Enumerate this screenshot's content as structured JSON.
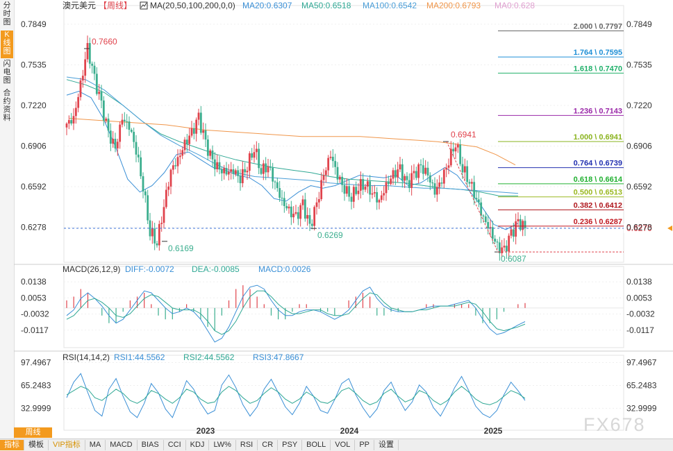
{
  "sidebar": {
    "items": [
      {
        "label": "分时图",
        "active": false
      },
      {
        "label": "K线图",
        "active": true
      },
      {
        "label": "闪电图",
        "active": false
      },
      {
        "label": "合约资料",
        "active": false
      }
    ]
  },
  "header": {
    "symbol": "澳元美元",
    "period_tag": "【周线】",
    "ma_label": "MA(20,50,100,200,0,0)",
    "ma_values": [
      {
        "label": "MA20:0.6307",
        "color": "#3a8fd6"
      },
      {
        "label": "MA50:0.6518",
        "color": "#2fa894"
      },
      {
        "label": "MA100:0.6542",
        "color": "#4a9ed8"
      },
      {
        "label": "MA200:0.6793",
        "color": "#f0964a"
      },
      {
        "label": "MA0:0.628",
        "color": "#e0a0d0"
      }
    ]
  },
  "macd_header": {
    "label": "MACD(26,12,9)",
    "values": [
      {
        "label": "DIFF:-0.0072",
        "color": "#3a8fd6"
      },
      {
        "label": "DEA:-0.0085",
        "color": "#2fa894"
      },
      {
        "label": "MACD:0.0026",
        "color": "#3a8fd6"
      }
    ]
  },
  "rsi_header": {
    "label": "RSI(14,14,2)",
    "values": [
      {
        "label": "RSI1:44.5562",
        "color": "#3a8fd6"
      },
      {
        "label": "RSI2:44.5562",
        "color": "#2fa894"
      },
      {
        "label": "RSI3:47.8667",
        "color": "#3a8fd6"
      }
    ]
  },
  "x_axis": {
    "labels": [
      "2023",
      "2024",
      "2025"
    ]
  },
  "period_button": "周线",
  "watermark": "FX678",
  "toolbar": {
    "items": [
      "指标",
      "模板",
      "VIP指标",
      "MA",
      "MACD",
      "BIAS",
      "CCI",
      "KDJ",
      "LW%",
      "RSI",
      "CR",
      "PSY",
      "BOLL",
      "VOL",
      "PP",
      "设置"
    ]
  },
  "colors": {
    "up": "#e0434c",
    "down": "#3bae8e",
    "current_price": "#e0434c"
  },
  "chart_data": {
    "type": "candlestick",
    "price_axis": {
      "ticks": [
        "0.7849",
        "0.7535",
        "0.7220",
        "0.6906",
        "0.6592",
        "0.6278"
      ],
      "ylim": [
        0.605,
        0.795
      ]
    },
    "current_price": "0.6270",
    "fib_levels": [
      {
        "label": "2.000 \\ 0.7797",
        "value": 0.7797,
        "color": "#666666"
      },
      {
        "label": "1.764 \\ 0.7595",
        "value": 0.7595,
        "color": "#1e8fd6"
      },
      {
        "label": "1.618 \\ 0.7470",
        "value": 0.747,
        "color": "#20b06a"
      },
      {
        "label": "1.236 \\ 0.7143",
        "value": 0.7143,
        "color": "#9a28a8"
      },
      {
        "label": "1.000 \\ 0.6941",
        "value": 0.6941,
        "color": "#8ab31e"
      },
      {
        "label": "0.764 \\ 0.6739",
        "value": 0.6739,
        "color": "#2230b0"
      },
      {
        "label": "0.618 \\ 0.6614",
        "value": 0.6614,
        "color": "#20b030"
      },
      {
        "label": "0.500 \\ 0.6513",
        "value": 0.6513,
        "color": "#9ab820"
      },
      {
        "label": "0.382 \\ 0.6412",
        "value": 0.6412,
        "color": "#b0181e"
      },
      {
        "label": "0.236 \\ 0.6287",
        "value": 0.6287,
        "color": "#c01820"
      }
    ],
    "price_annotations": [
      {
        "label": "0.7660",
        "value": 0.766,
        "color": "#e0434c"
      },
      {
        "label": "0.6169",
        "value": 0.6169,
        "color": "#3bae8e"
      },
      {
        "label": "0.6269",
        "value": 0.6269,
        "color": "#3bae8e"
      },
      {
        "label": "0.6941",
        "value": 0.6941,
        "color": "#e0434c"
      },
      {
        "label": "0.6087",
        "value": 0.6087,
        "color": "#3bae8e"
      }
    ],
    "trend_line": {
      "from": 0.6941,
      "to": 0.6087
    },
    "anchors": [
      0.708,
      0.712,
      0.738,
      0.766,
      0.742,
      0.722,
      0.7,
      0.688,
      0.712,
      0.706,
      0.688,
      0.66,
      0.625,
      0.617,
      0.645,
      0.672,
      0.68,
      0.692,
      0.7,
      0.712,
      0.692,
      0.678,
      0.672,
      0.67,
      0.672,
      0.666,
      0.676,
      0.69,
      0.672,
      0.676,
      0.662,
      0.648,
      0.64,
      0.635,
      0.645,
      0.627,
      0.645,
      0.668,
      0.684,
      0.668,
      0.658,
      0.652,
      0.66,
      0.662,
      0.655,
      0.648,
      0.66,
      0.668,
      0.672,
      0.66,
      0.668,
      0.674,
      0.668,
      0.655,
      0.665,
      0.68,
      0.694,
      0.674,
      0.664,
      0.65,
      0.635,
      0.625,
      0.612,
      0.609,
      0.622,
      0.631,
      0.627
    ],
    "ma_lines": [
      {
        "name": "MA20",
        "color": "#3a8fd6",
        "points": [
          0.73,
          0.733,
          0.728,
          0.712,
          0.69,
          0.665,
          0.655,
          0.66,
          0.67,
          0.684,
          0.686,
          0.68,
          0.674,
          0.672,
          0.668,
          0.666,
          0.66,
          0.65,
          0.648,
          0.655,
          0.66,
          0.658,
          0.66,
          0.664,
          0.668,
          0.667,
          0.666,
          0.668,
          0.66,
          0.662,
          0.668,
          0.674,
          0.668,
          0.656,
          0.644,
          0.63,
          0.626,
          0.631
        ]
      },
      {
        "name": "MA50",
        "color": "#2fa894",
        "points": [
          0.742,
          0.738,
          0.732,
          0.722,
          0.71,
          0.7,
          0.694,
          0.689,
          0.684,
          0.68,
          0.677,
          0.674,
          0.672,
          0.67,
          0.667,
          0.665,
          0.664,
          0.663,
          0.662,
          0.66,
          0.658,
          0.657,
          0.655,
          0.652,
          0.652
        ]
      },
      {
        "name": "MA100",
        "color": "#4a9ed8",
        "points": [
          0.744,
          0.742,
          0.734,
          0.722,
          0.71,
          0.699,
          0.691,
          0.684,
          0.676,
          0.67,
          0.667,
          0.666,
          0.665,
          0.664,
          0.662,
          0.661,
          0.66,
          0.66,
          0.659,
          0.658,
          0.658,
          0.657,
          0.656,
          0.655,
          0.654
        ]
      },
      {
        "name": "MA200",
        "color": "#f0964a",
        "points": [
          0.712,
          0.711,
          0.71,
          0.709,
          0.708,
          0.707,
          0.705,
          0.703,
          0.702,
          0.701,
          0.7,
          0.699,
          0.698,
          0.698,
          0.698,
          0.698,
          0.697,
          0.696,
          0.695,
          0.694,
          0.692,
          0.69,
          0.684,
          0.676
        ]
      }
    ],
    "macd": {
      "ticks": [
        "0.0138",
        "0.0053",
        "-0.0032",
        "-0.0117"
      ],
      "ylim": [
        -0.018,
        0.019
      ],
      "diff": [
        -0.004,
        -0.001,
        0.005,
        0.008,
        0.005,
        0.001,
        -0.004,
        -0.008,
        -0.006,
        -0.001,
        0.004,
        0.009,
        0.008,
        0.004,
        0.0,
        -0.003,
        -0.002,
        0.0,
        -0.002,
        -0.006,
        -0.012,
        -0.018,
        -0.016,
        -0.01,
        -0.002,
        0.006,
        0.011,
        0.012,
        0.01,
        0.004,
        -0.001,
        -0.004,
        -0.004,
        -0.002,
        -0.001,
        -0.001,
        -0.002,
        -0.004,
        -0.006,
        -0.004,
        -0.001,
        0.004,
        0.009,
        0.011,
        0.005,
        0.001,
        -0.001,
        -0.002,
        -0.002,
        -0.002,
        -0.001,
        0.0,
        0.001,
        0.001,
        0.001,
        0.002,
        0.003,
        0.004,
        0.0,
        -0.006,
        -0.011,
        -0.014,
        -0.013,
        -0.011,
        -0.009,
        -0.0072
      ],
      "dea": [
        -0.006,
        -0.004,
        0.0,
        0.004,
        0.005,
        0.003,
        0.0,
        -0.004,
        -0.005,
        -0.003,
        0.001,
        0.005,
        0.007,
        0.006,
        0.003,
        0.0,
        -0.001,
        -0.001,
        -0.001,
        -0.003,
        -0.007,
        -0.012,
        -0.014,
        -0.012,
        -0.007,
        0.0,
        0.006,
        0.009,
        0.009,
        0.006,
        0.002,
        -0.001,
        -0.003,
        -0.003,
        -0.002,
        -0.001,
        -0.001,
        -0.003,
        -0.004,
        -0.004,
        -0.003,
        0.001,
        0.005,
        0.008,
        0.007,
        0.003,
        0.0,
        -0.001,
        -0.002,
        -0.002,
        -0.001,
        -0.001,
        0.0,
        0.001,
        0.001,
        0.001,
        0.002,
        0.003,
        0.002,
        -0.002,
        -0.007,
        -0.011,
        -0.012,
        -0.011,
        -0.01,
        -0.0085
      ]
    },
    "rsi": {
      "ticks": [
        "97.4967",
        "65.2483",
        "32.9999"
      ],
      "ylim": [
        10,
        100
      ],
      "rsi1": [
        48,
        70,
        82,
        55,
        30,
        22,
        60,
        75,
        50,
        28,
        20,
        40,
        68,
        55,
        32,
        20,
        45,
        72,
        60,
        40,
        25,
        30,
        66,
        80,
        62,
        38,
        22,
        35,
        60,
        74,
        55,
        35,
        24,
        40,
        64,
        50,
        30,
        26,
        45,
        68,
        75,
        52,
        34,
        20,
        32,
        58,
        70,
        48,
        30,
        42,
        66,
        56,
        34,
        22,
        40,
        62,
        78,
        58,
        36,
        25,
        20,
        30,
        52,
        70,
        58,
        44
      ],
      "rsi2": [
        52,
        58,
        64,
        60,
        48,
        44,
        52,
        60,
        54,
        44,
        40,
        46,
        58,
        54,
        46,
        40,
        48,
        60,
        56,
        46,
        40,
        42,
        56,
        64,
        58,
        48,
        40,
        44,
        54,
        62,
        56,
        46,
        40,
        46,
        56,
        50,
        42,
        40,
        46,
        58,
        62,
        54,
        44,
        38,
        42,
        54,
        60,
        50,
        42,
        46,
        58,
        54,
        44,
        38,
        44,
        56,
        64,
        56,
        46,
        40,
        38,
        42,
        50,
        58,
        54,
        47
      ]
    }
  }
}
